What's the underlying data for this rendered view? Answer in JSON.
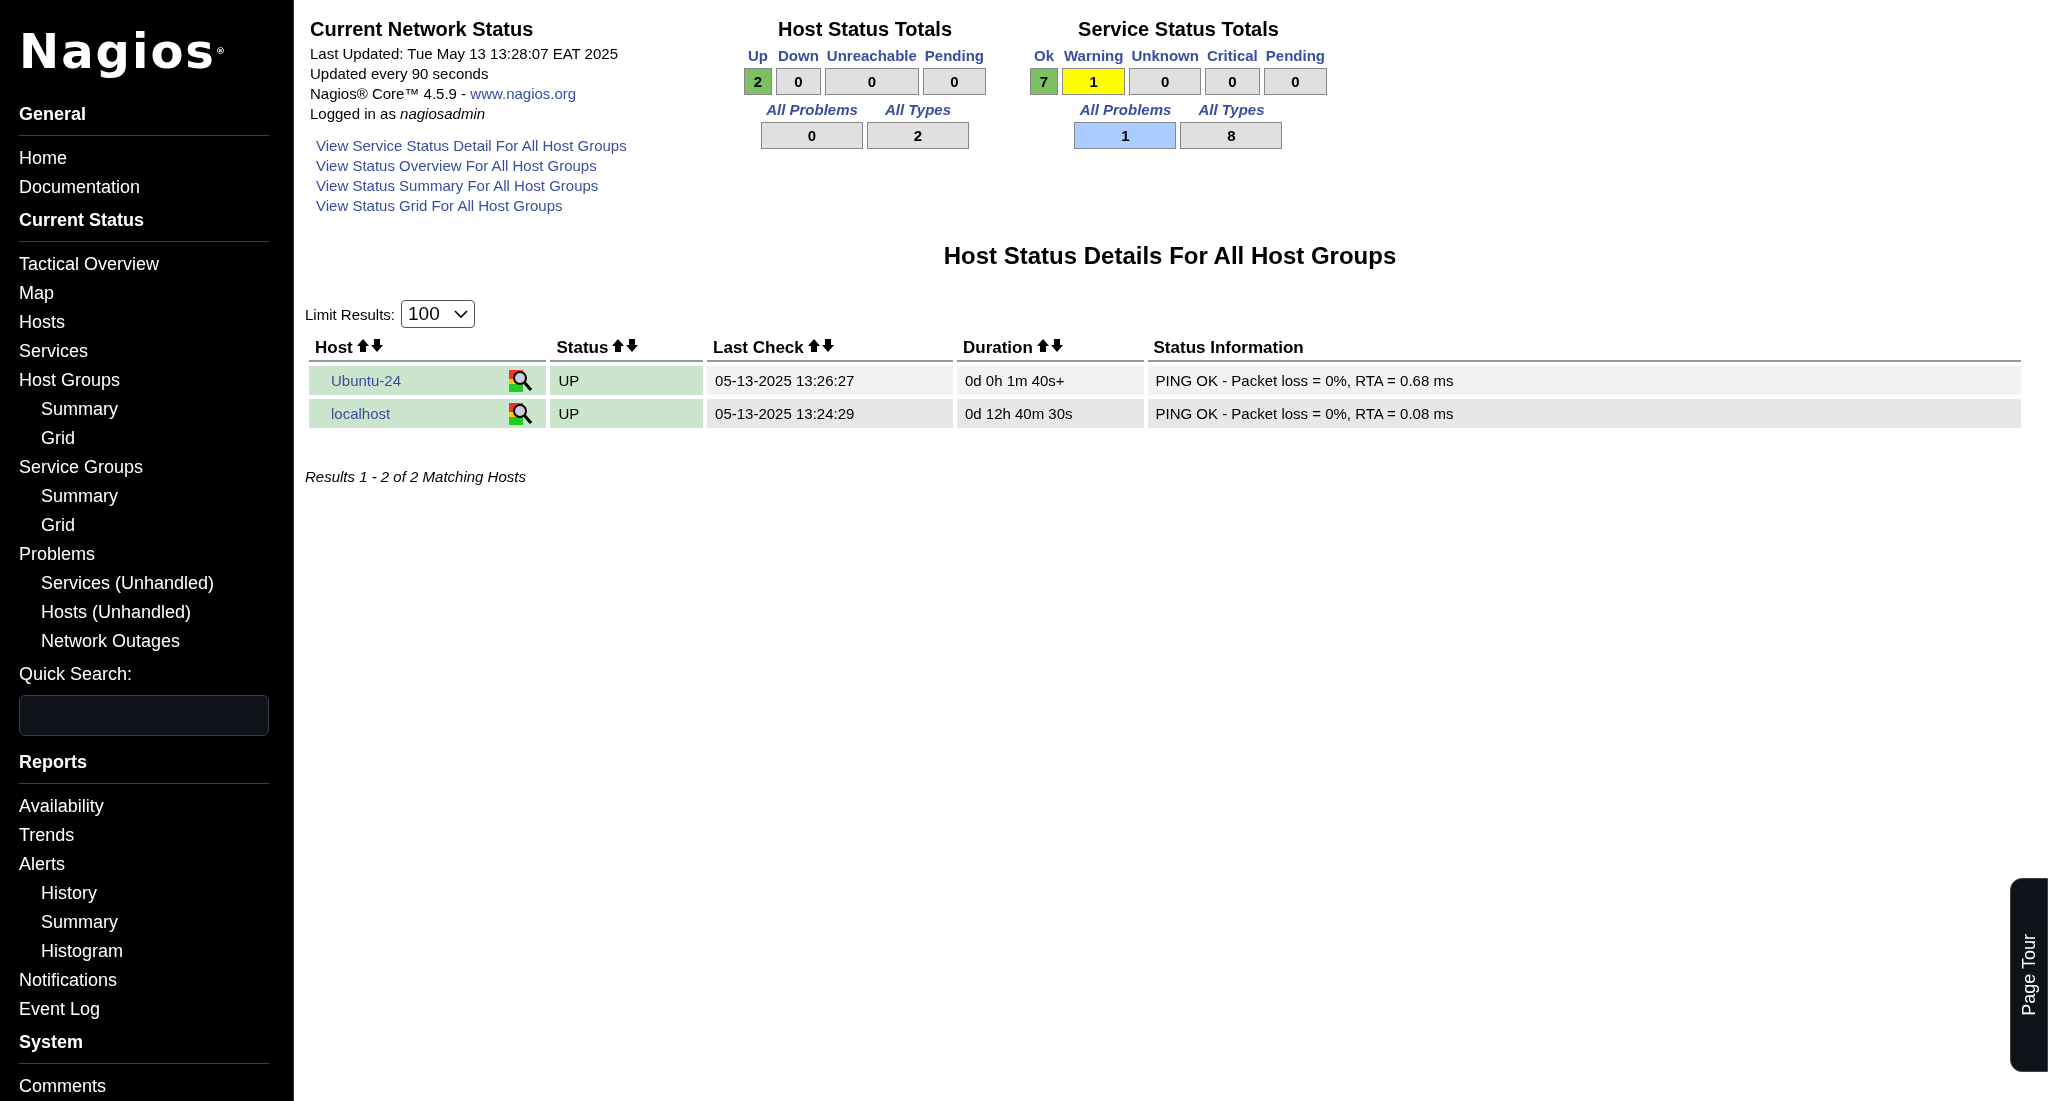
{
  "sidebar": {
    "logo": "Nagios",
    "logo_mark": "®",
    "sections": [
      {
        "title": "General",
        "items": [
          {
            "label": "Home"
          },
          {
            "label": "Documentation"
          }
        ]
      },
      {
        "title": "Current Status",
        "items": [
          {
            "label": "Tactical Overview"
          },
          {
            "label": "Map"
          },
          {
            "label": "Hosts"
          },
          {
            "label": "Services"
          },
          {
            "label": "Host Groups",
            "children": [
              {
                "label": "Summary"
              },
              {
                "label": "Grid"
              }
            ]
          },
          {
            "label": "Service Groups",
            "children": [
              {
                "label": "Summary"
              },
              {
                "label": "Grid"
              }
            ]
          },
          {
            "label": "Problems",
            "children": [
              {
                "label": "Services (Unhandled)"
              },
              {
                "label": "Hosts (Unhandled)"
              },
              {
                "label": "Network Outages"
              }
            ]
          }
        ],
        "quick_search": {
          "label": "Quick Search:"
        }
      },
      {
        "title": "Reports",
        "items": [
          {
            "label": "Availability"
          },
          {
            "label": "Trends"
          },
          {
            "label": "Alerts",
            "children": [
              {
                "label": "History"
              },
              {
                "label": "Summary"
              },
              {
                "label": "Histogram"
              }
            ]
          },
          {
            "label": "Notifications"
          },
          {
            "label": "Event Log"
          }
        ]
      },
      {
        "title": "System",
        "items": [
          {
            "label": "Comments"
          }
        ]
      }
    ]
  },
  "info": {
    "title": "Current Network Status",
    "last_updated": "Last Updated: Tue May 13 13:28:07 EAT 2025",
    "refresh": "Updated every 90 seconds",
    "version": "Nagios® Core™ 4.5.9 - ",
    "website_link": "www.nagios.org",
    "login": "Logged in as *nagiosadmin*",
    "links": [
      "View Service Status Detail For All Host Groups",
      "View Status Overview For All Host Groups",
      "View Status Summary For All Host Groups",
      "View Status Grid For All Host Groups"
    ]
  },
  "host_totals": {
    "title": "Host Status Totals",
    "counts": [
      {
        "label": "Up",
        "value": "2",
        "color": "#7cc063"
      },
      {
        "label": "Down",
        "value": "0",
        "color": "#e0e0e0"
      },
      {
        "label": "Unreachable",
        "value": "0",
        "color": "#e0e0e0"
      },
      {
        "label": "Pending",
        "value": "0",
        "color": "#e0e0e0"
      }
    ],
    "summary": [
      {
        "label": "All Problems",
        "value": "0",
        "color": "#e0e0e0"
      },
      {
        "label": "All Types",
        "value": "2",
        "color": "#e0e0e0"
      }
    ]
  },
  "service_totals": {
    "title": "Service Status Totals",
    "counts": [
      {
        "label": "Ok",
        "value": "7",
        "color": "#7cc063"
      },
      {
        "label": "Warning",
        "value": "1",
        "color": "#ffff00"
      },
      {
        "label": "Unknown",
        "value": "0",
        "color": "#e0e0e0"
      },
      {
        "label": "Critical",
        "value": "0",
        "color": "#e0e0e0"
      },
      {
        "label": "Pending",
        "value": "0",
        "color": "#e0e0e0"
      }
    ],
    "summary": [
      {
        "label": "All Problems",
        "value": "1",
        "color": "#aaccff"
      },
      {
        "label": "All Types",
        "value": "8",
        "color": "#e0e0e0"
      }
    ]
  },
  "details": {
    "title": "Host Status Details For All Host Groups",
    "limit_label": "Limit Results:",
    "limit_value": "100",
    "columns": [
      {
        "label": "Host",
        "sortable": true
      },
      {
        "label": "Status",
        "sortable": true
      },
      {
        "label": "Last Check",
        "sortable": true
      },
      {
        "label": "Duration",
        "sortable": true
      },
      {
        "label": "Status Information",
        "sortable": false
      }
    ],
    "rows": [
      {
        "host": "Ubuntu-24",
        "status": "UP",
        "color": "#cbe6cc",
        "last_check": "05-13-2025 13:26:27",
        "duration": "0d 0h 1m 40s+",
        "info": "PING OK - Packet loss = 0%, RTA = 0.68 ms"
      },
      {
        "host": "localhost",
        "status": "UP",
        "color": "#cbe6cc",
        "last_check": "05-13-2025 13:24:29",
        "duration": "0d 12h 40m 30s",
        "info": "PING OK - Packet loss = 0%, RTA = 0.08 ms"
      }
    ],
    "results": "Results 1 - 2 of 2 Matching Hosts"
  },
  "page_tour": {
    "label": "Page Tour"
  }
}
